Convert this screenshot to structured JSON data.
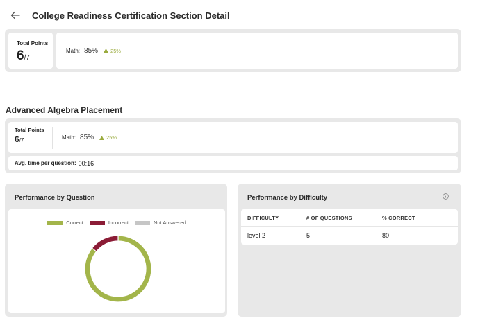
{
  "page": {
    "title": "College Readiness Certification Section Detail"
  },
  "summary": {
    "total_points_label": "Total Points",
    "points": "6",
    "points_total": "/7",
    "subject": "Math:",
    "percent": "85%",
    "trend": "25%"
  },
  "section": {
    "title": "Advanced Algebra Placement",
    "total_points_label": "Total Points",
    "points": "6",
    "points_total": "/7",
    "subject": "Math:",
    "percent": "85%",
    "trend": "25%",
    "avg_label": "Avg. time per question:",
    "avg_value": "00:16"
  },
  "performance_by_question": {
    "title": "Performance by Question",
    "legend": [
      {
        "label": "Correct",
        "color": "#a3b54a"
      },
      {
        "label": "Incorrect",
        "color": "#8b1c36"
      },
      {
        "label": "Not Answered",
        "color": "#c6c6c6"
      }
    ]
  },
  "chart_data": {
    "type": "pie",
    "donut": true,
    "series": [
      {
        "name": "Correct",
        "value": 6,
        "color": "#a3b54a"
      },
      {
        "name": "Incorrect",
        "value": 1,
        "color": "#8b1c36"
      },
      {
        "name": "Not Answered",
        "value": 0,
        "color": "#c6c6c6"
      }
    ],
    "legend_position": "top"
  },
  "performance_by_difficulty": {
    "title": "Performance by Difficulty",
    "columns": [
      "DIFFICULTY",
      "# OF QUESTIONS",
      "% CORRECT"
    ],
    "rows": [
      [
        "level 2",
        "5",
        "80"
      ]
    ]
  },
  "colors": {
    "accent_trend": "#9aab3e",
    "panel_bg": "#e8e8e8"
  },
  "icons": {
    "back": "arrow-left-icon",
    "info": "info-icon",
    "trend": "triangle-up-icon"
  }
}
